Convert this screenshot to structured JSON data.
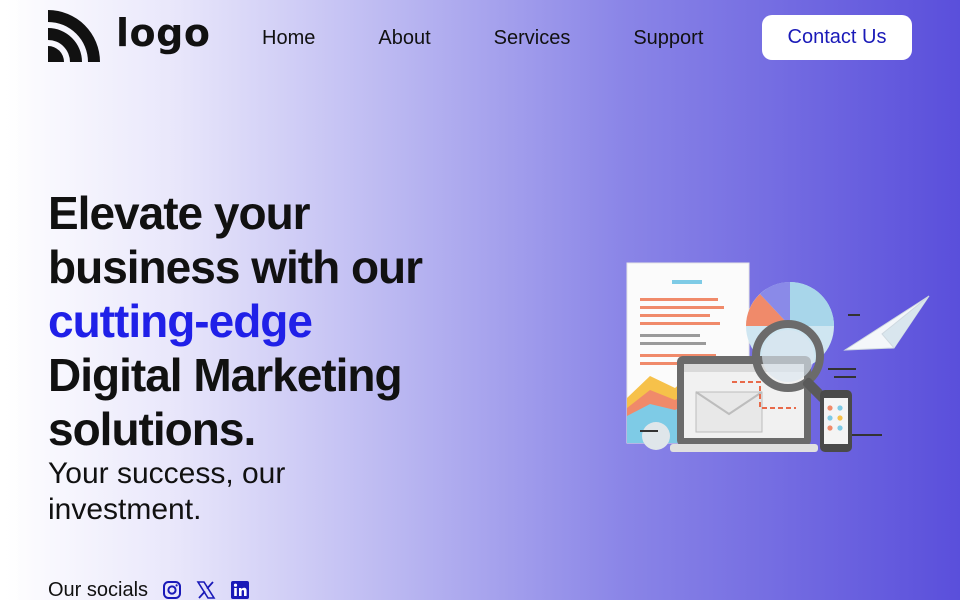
{
  "logo": {
    "text": "logo"
  },
  "nav": {
    "items": [
      {
        "label": "Home"
      },
      {
        "label": "About"
      },
      {
        "label": "Services"
      },
      {
        "label": "Support"
      }
    ]
  },
  "header": {
    "contact_label": "Contact Us"
  },
  "hero": {
    "title_line1": "Elevate your",
    "title_line2": "business with our",
    "title_accent": "cutting-edge",
    "title_line4": "Digital Marketing",
    "title_line5": "solutions.",
    "subtitle": "Your success, our investment."
  },
  "socials": {
    "label": "Our socials",
    "icons": [
      "instagram-icon",
      "x-icon",
      "linkedin-icon"
    ]
  },
  "colors": {
    "accent": "#2020e8",
    "gradient_end": "#5a4fdb",
    "button_text": "#1a1ab8"
  }
}
